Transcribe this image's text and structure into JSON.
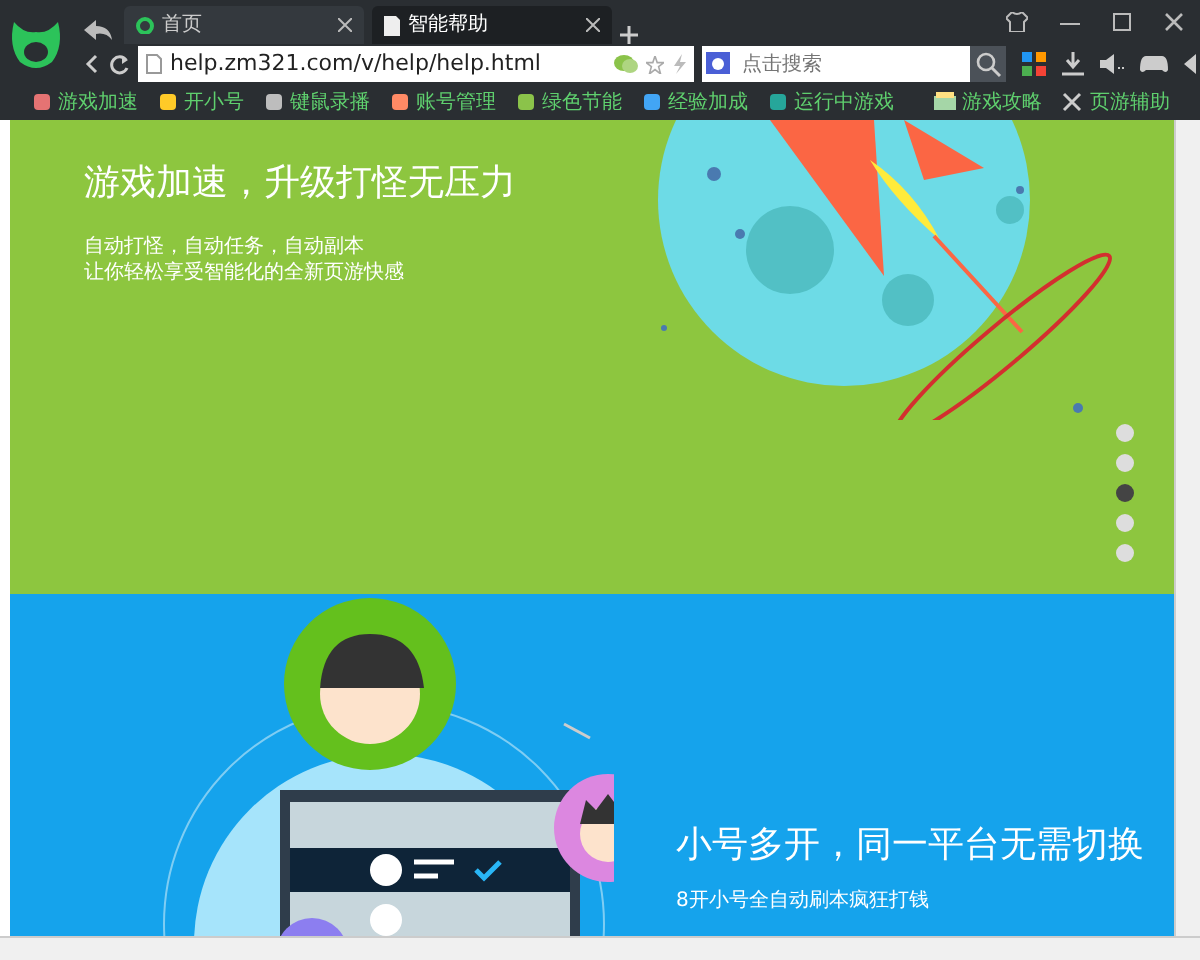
{
  "browser": {
    "tabs": [
      {
        "title": "首页",
        "selected": false
      },
      {
        "title": "智能帮助",
        "selected": true
      }
    ],
    "address": "help.zm321.com/v/help/help.html",
    "search": {
      "placeholder": "点击搜索"
    },
    "bookmarks": [
      {
        "label": "游戏加速"
      },
      {
        "label": "开小号"
      },
      {
        "label": "键鼠录播"
      },
      {
        "label": "账号管理"
      },
      {
        "label": "绿色节能"
      },
      {
        "label": "经验加成"
      },
      {
        "label": "运行中游戏"
      }
    ],
    "bookmarks_right": [
      {
        "label": "游戏攻略"
      },
      {
        "label": "页游辅助"
      }
    ]
  },
  "sections": [
    {
      "kind": "rocket",
      "heading": "游戏加速，升级打怪无压力",
      "lines": [
        "自动打怪，自动任务，自动副本",
        "让你轻松享受智能化的全新页游快感"
      ]
    },
    {
      "kind": "accounts",
      "heading": "小号多开，同一平台无需切换",
      "lines": [
        "8开小号全自动刷本疯狂打钱"
      ]
    }
  ],
  "pager": [
    {
      "selected": false
    },
    {
      "selected": false
    },
    {
      "selected": true
    },
    {
      "selected": false
    },
    {
      "selected": false
    }
  ]
}
